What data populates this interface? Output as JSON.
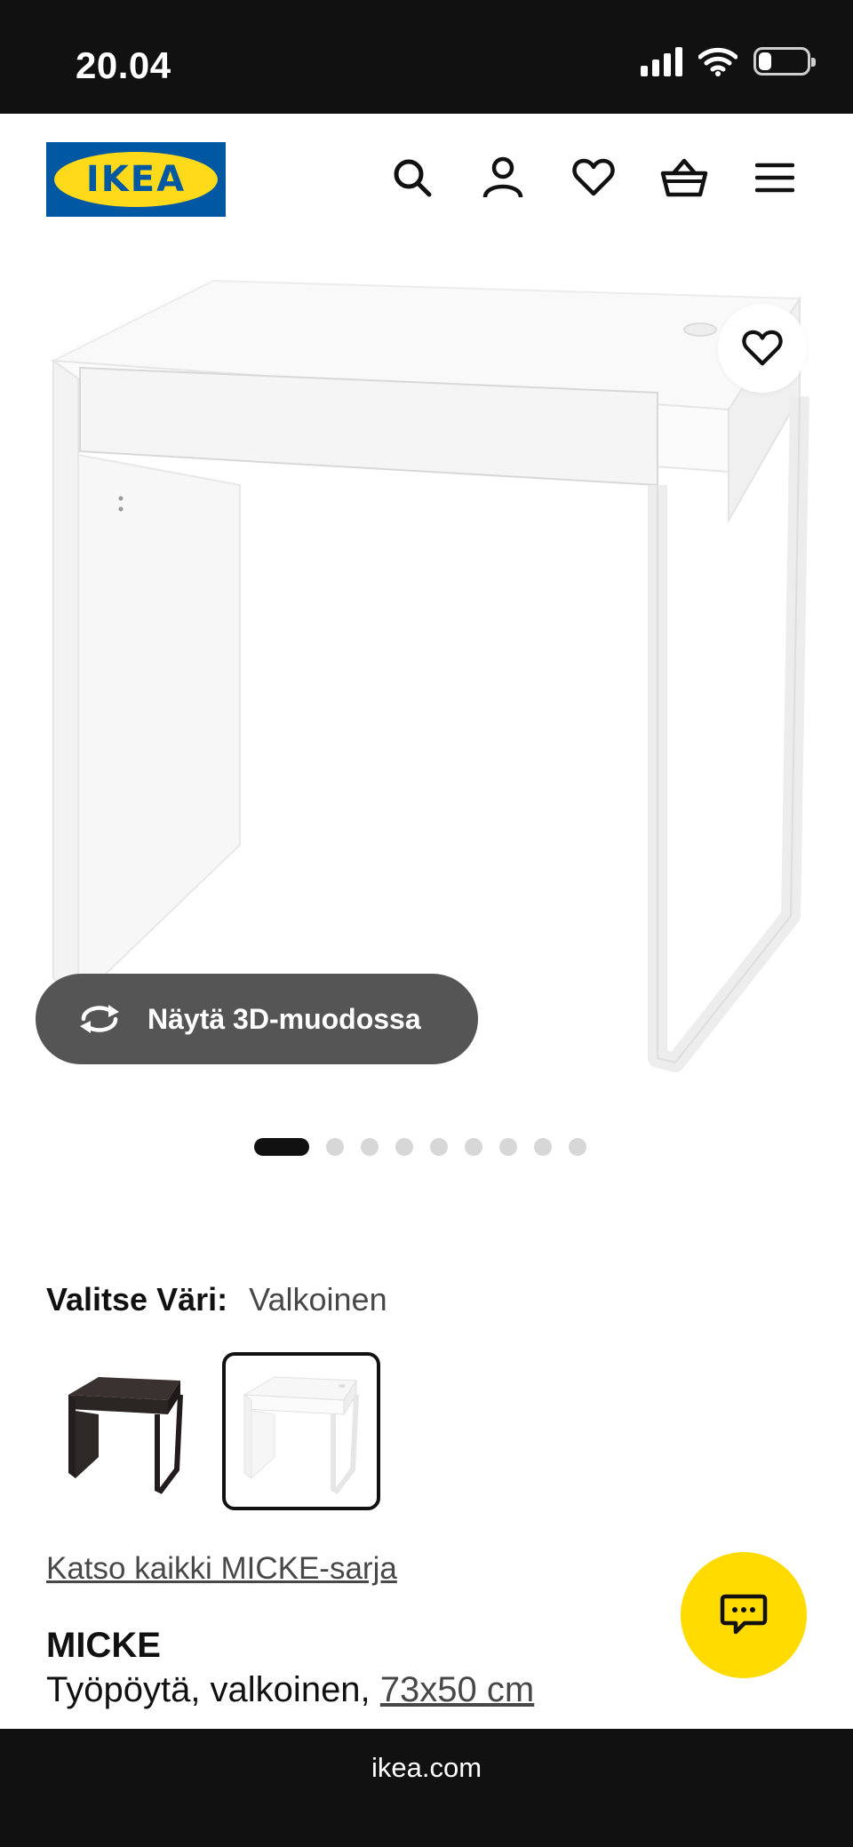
{
  "status_bar": {
    "time": "20.04"
  },
  "header": {
    "logo_text": "IKEA",
    "icons": [
      "search-icon",
      "profile-icon",
      "heart-icon",
      "basket-icon",
      "menu-icon"
    ]
  },
  "gallery": {
    "view_3d_label": "Näytä 3D-muodossa",
    "image_count": 9,
    "active_index": 0
  },
  "color_selector": {
    "label": "Valitse Väri:",
    "selected_value": "Valkoinen",
    "options": [
      {
        "name": "black-brown",
        "color": "#2b2523",
        "selected": false
      },
      {
        "name": "white",
        "color": "#ffffff",
        "selected": true
      }
    ]
  },
  "series_link": "Katso kaikki MICKE-sarja",
  "product": {
    "name": "MICKE",
    "description": "Työpöytä, valkoinen,",
    "size": "73x50 cm"
  },
  "browser": {
    "url": "ikea.com"
  },
  "colors": {
    "ikea_blue": "#0058a3",
    "ikea_yellow": "#ffda1a",
    "chat_yellow": "#ffdb00",
    "button_gray": "#555555"
  }
}
